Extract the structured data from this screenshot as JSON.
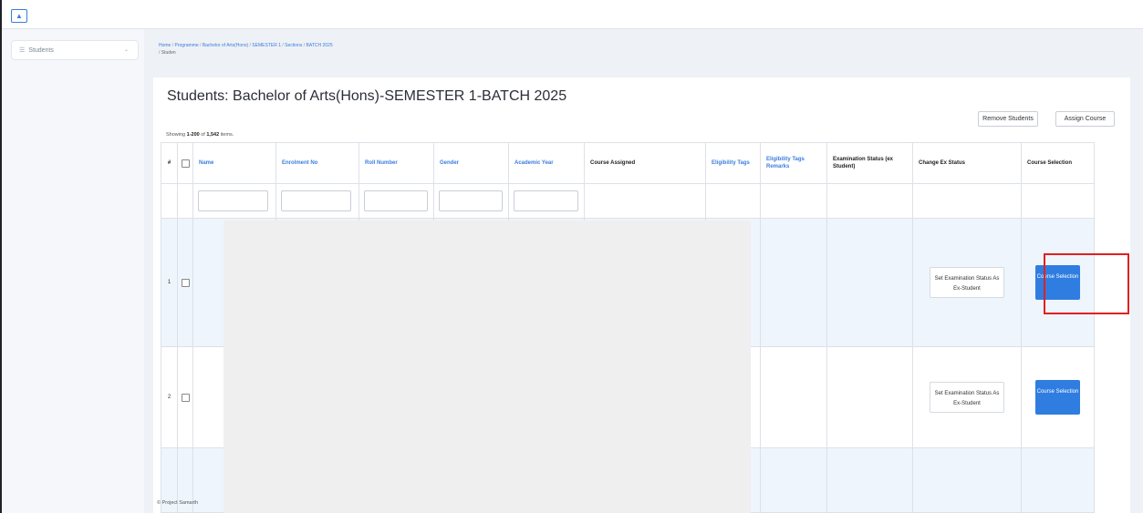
{
  "topbar": {
    "home_icon": "home-icon"
  },
  "sidebar": {
    "items": [
      {
        "label": "Students",
        "icon": "students-icon"
      }
    ]
  },
  "breadcrumb": {
    "items": [
      "Home",
      "Programme",
      "Bachelor of Arts(Hons)",
      "SEMESTER 1",
      "Sections",
      "BATCH 2025"
    ],
    "current": "Studen"
  },
  "page": {
    "title": "Students: Bachelor of Arts(Hons)-SEMESTER 1-BATCH 2025",
    "remove_students": "Remove Students",
    "assign_course": "Assign Course",
    "summary_prefix": "Showing ",
    "summary_range": "1-200",
    "summary_of": " of ",
    "summary_total": "1,542",
    "summary_suffix": " items."
  },
  "table": {
    "columns": {
      "num": "#",
      "name": "Name",
      "enrolment": "Enrolment No",
      "roll": "Roll Number",
      "gender": "Gender",
      "year": "Academic Year",
      "course_assigned": "Course Assigned",
      "eligibility": "Eligibility Tags",
      "eligibility_remarks": "Eligibility Tags Remarks",
      "exam_status": "Examination Status (ex Student)",
      "change_ex": "Change Ex Status",
      "course_selection": "Course Selection"
    },
    "rows": [
      {
        "num": "1",
        "set_status": "Set Examination Status As Ex-Student",
        "course_selection": "Course Selection"
      },
      {
        "num": "2",
        "set_status": "Set Examination Status As Ex-Student",
        "course_selection": "Course Selection"
      }
    ]
  },
  "footer": {
    "text": "© Project Samarth"
  },
  "colors": {
    "accent": "#2f7de1",
    "highlight": "#e02020",
    "link": "#3b7ddd"
  }
}
